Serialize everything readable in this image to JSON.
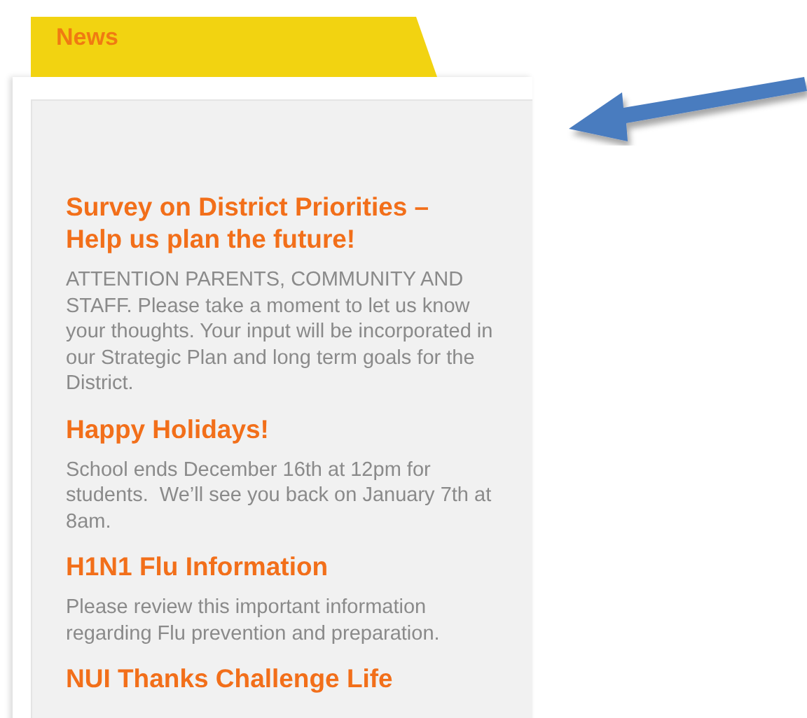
{
  "tab": {
    "label": "News"
  },
  "items": [
    {
      "title": "Survey on District Priorities – Help us plan the future!",
      "body": "ATTENTION PARENTS, COMMUNITY AND STAFF. Please take a moment to let us know your thoughts. Your input will be incorporated in our Strategic Plan and long term goals for the District."
    },
    {
      "title": "Happy Holidays!",
      "body": "School ends December 16th at 12pm for students.  We’ll see you back on January 7th at 8am."
    },
    {
      "title": "H1N1 Flu Information",
      "body": "Please review this important information regarding Flu prevention and preparation."
    },
    {
      "title": "NUI Thanks Challenge Life"
    }
  ]
}
